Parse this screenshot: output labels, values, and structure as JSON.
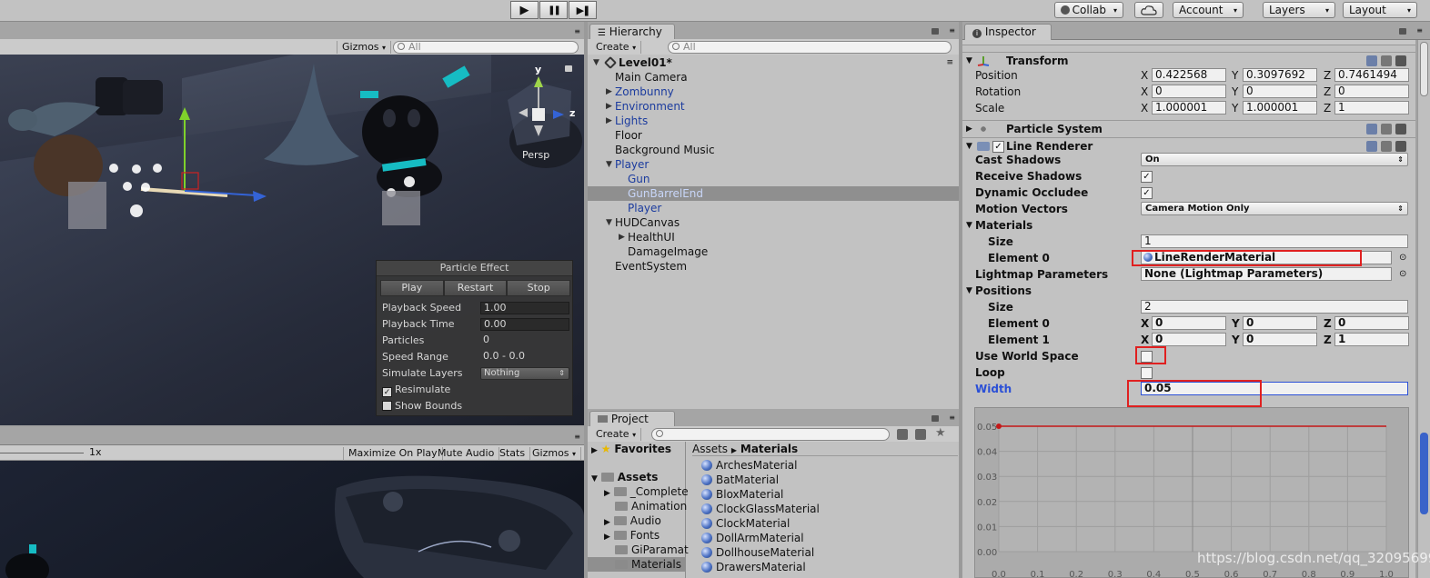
{
  "toolbar": {
    "play_label": "▶",
    "pause_label": "❚❚",
    "step_label": "▶❚",
    "collab": "Collab",
    "cloud_icon": "cloud-icon",
    "account": "Account",
    "layers": "Layers",
    "layout": "Layout",
    "dropdown_arrow": "▾"
  },
  "scene": {
    "gizmos": "Gizmos",
    "search_placeholder": "All",
    "persp": "Persp",
    "axis_x": "x",
    "axis_y": "y",
    "axis_z": "z",
    "particle_effect": {
      "title": "Particle Effect",
      "buttons": [
        "Play",
        "Restart",
        "Stop"
      ],
      "rows": [
        {
          "label": "Playback Speed",
          "value": "1.00"
        },
        {
          "label": "Playback Time",
          "value": "0.00"
        },
        {
          "label": "Particles",
          "value": "0"
        },
        {
          "label": "Speed Range",
          "value": "0.0 - 0.0"
        },
        {
          "label": "Simulate Layers",
          "value": "Nothing"
        }
      ],
      "resimulate": "Resimulate",
      "show_bounds": "Show Bounds",
      "checkmark": "✓"
    }
  },
  "game": {
    "scale": "1x",
    "buttons": [
      "Maximize On Play",
      "Mute Audio",
      "Stats",
      "Gizmos"
    ]
  },
  "hierarchy": {
    "tab": "Hierarchy",
    "create": "Create",
    "search_placeholder": "All",
    "scene_name": "Level01*",
    "items": [
      {
        "label": "Main Camera"
      },
      {
        "label": "Zombunny"
      },
      {
        "label": "Environment"
      },
      {
        "label": "Lights"
      },
      {
        "label": "Floor"
      },
      {
        "label": "Background Music"
      },
      {
        "label": "Player"
      },
      {
        "label": "Gun"
      },
      {
        "label": "GunBarrelEnd"
      },
      {
        "label": "Player"
      },
      {
        "label": "HUDCanvas"
      },
      {
        "label": "HealthUI"
      },
      {
        "label": "DamageImage"
      },
      {
        "label": "EventSystem"
      }
    ]
  },
  "project": {
    "tab": "Project",
    "create": "Create",
    "favorites": "Favorites",
    "assets": "Assets",
    "folders": [
      "_Complete",
      "Animation",
      "Audio",
      "Fonts",
      "GiParamat",
      "Materials"
    ],
    "breadcrumb": {
      "root": "Assets",
      "separator": "▶",
      "current": "Materials"
    },
    "materials": [
      "ArchesMaterial",
      "BatMaterial",
      "BloxMaterial",
      "ClockGlassMaterial",
      "ClockMaterial",
      "DollArmMaterial",
      "DollhouseMaterial",
      "DrawersMaterial"
    ]
  },
  "inspector": {
    "tab": "Inspector",
    "transform": {
      "title": "Transform",
      "rows": [
        {
          "label": "Position",
          "x": "0.422568",
          "y": "0.3097692",
          "z": "0.7461494"
        },
        {
          "label": "Rotation",
          "x": "0",
          "y": "0",
          "z": "0"
        },
        {
          "label": "Scale",
          "x": "1.000001",
          "y": "1.000001",
          "z": "1"
        }
      ],
      "axis": {
        "x": "X",
        "y": "Y",
        "z": "Z"
      }
    },
    "particle_system": {
      "title": "Particle System"
    },
    "line_renderer": {
      "title": "Line Renderer",
      "cast_shadows": {
        "label": "Cast Shadows",
        "value": "On"
      },
      "receive_shadows": {
        "label": "Receive Shadows"
      },
      "dynamic_occludee": {
        "label": "Dynamic Occludee"
      },
      "motion_vectors": {
        "label": "Motion Vectors",
        "value": "Camera Motion Only"
      },
      "materials": {
        "label": "Materials",
        "size_label": "Size",
        "size": "1",
        "element0_label": "Element 0",
        "element0": "LineRenderMaterial"
      },
      "lightmap": {
        "label": "Lightmap Parameters",
        "value": "None (Lightmap Parameters)"
      },
      "positions": {
        "label": "Positions",
        "size_label": "Size",
        "size": "2",
        "elements": [
          {
            "label": "Element 0",
            "x": "0",
            "y": "0",
            "z": "0"
          },
          {
            "label": "Element 1",
            "x": "0",
            "y": "0",
            "z": "1"
          }
        ]
      },
      "use_world_space": {
        "label": "Use World Space"
      },
      "loop": {
        "label": "Loop"
      },
      "width": {
        "label": "Width",
        "value": "0.05"
      },
      "checkmark": "✓"
    },
    "curve": {
      "y_ticks": [
        "0.05",
        "0.04",
        "0.03",
        "0.02",
        "0.01",
        "0.00"
      ],
      "x_ticks": [
        "0.0",
        "0.1",
        "0.2",
        "0.3",
        "0.4",
        "0.5",
        "0.6",
        "0.7",
        "0.8",
        "0.9",
        "1.0"
      ],
      "width_value": 0.05
    }
  },
  "watermark": "https://blog.csdn.net/qq_32095699",
  "colors": {
    "accent_blue": "#1b3b9e",
    "highlight_red": "#e02020",
    "width_label_blue": "#2a4fd6",
    "curve_red": "#c41818"
  }
}
